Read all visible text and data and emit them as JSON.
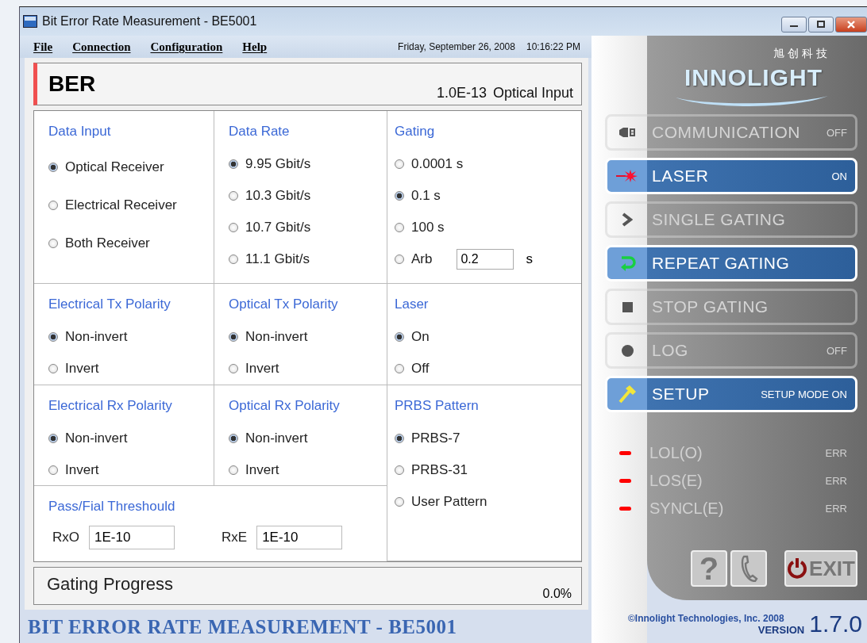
{
  "window": {
    "title": "Bit Error Rate Measurement - BE5001"
  },
  "menu": [
    {
      "label": "File"
    },
    {
      "label": "Connection"
    },
    {
      "label": "Configuration"
    },
    {
      "label": "Help"
    }
  ],
  "clock": {
    "date": "Friday, September 26, 2008",
    "time": "10:16:22 PM"
  },
  "ber": {
    "title": "BER",
    "value": "1.0E-13",
    "source": "Optical Input"
  },
  "groups": [
    {
      "title": "Data Input",
      "options": [
        {
          "label": "Optical Receiver",
          "selected": true
        },
        {
          "label": "Electrical Receiver",
          "selected": false
        },
        {
          "label": "Both Receiver",
          "selected": false
        }
      ]
    },
    {
      "title": "Data Rate",
      "options": [
        {
          "label": "9.95 Gbit/s",
          "selected": true
        },
        {
          "label": "10.3 Gbit/s",
          "selected": false
        },
        {
          "label": "10.7 Gbit/s",
          "selected": false
        },
        {
          "label": "11.1 Gbit/s",
          "selected": false
        }
      ]
    },
    {
      "title": "Gating",
      "options": [
        {
          "label": "0.0001 s",
          "selected": false
        },
        {
          "label": "0.1 s",
          "selected": true
        },
        {
          "label": "100 s",
          "selected": false
        },
        {
          "label": "Arb",
          "selected": false,
          "value": "0.2",
          "unit": "s"
        }
      ]
    },
    {
      "title": "Electrical Tx Polarity",
      "options": [
        {
          "label": "Non-invert",
          "selected": true
        },
        {
          "label": "Invert",
          "selected": false
        }
      ]
    },
    {
      "title": "Optical Tx Polarity",
      "options": [
        {
          "label": "Non-invert",
          "selected": true
        },
        {
          "label": "Invert",
          "selected": false
        }
      ]
    },
    {
      "title": "Laser",
      "options": [
        {
          "label": "On",
          "selected": true
        },
        {
          "label": "Off",
          "selected": false
        }
      ]
    },
    {
      "title": "Electrical Rx Polarity",
      "options": [
        {
          "label": "Non-invert",
          "selected": true
        },
        {
          "label": "Invert",
          "selected": false
        }
      ]
    },
    {
      "title": "Optical Rx Polarity",
      "options": [
        {
          "label": "Non-invert",
          "selected": true
        },
        {
          "label": "Invert",
          "selected": false
        }
      ]
    },
    {
      "title": "PRBS Pattern",
      "options": [
        {
          "label": "PRBS-7",
          "selected": true
        },
        {
          "label": "PRBS-31",
          "selected": false
        },
        {
          "label": "User Pattern",
          "selected": false
        }
      ]
    }
  ],
  "threshold": {
    "title": "Pass/Fial Threshould",
    "fields": [
      {
        "label": "RxO",
        "value": "1E-10"
      },
      {
        "label": "RxE",
        "value": "1E-10"
      }
    ]
  },
  "progress": {
    "label": "Gating Progress",
    "reading": "0.0%"
  },
  "footer_title": "BIT ERROR RATE MEASUREMENT - BE5001",
  "logo": {
    "name": "INNOLIGHT",
    "subtitle": "旭创科技"
  },
  "controls": [
    {
      "label": "COMMUNICATION",
      "status": "OFF",
      "active": false
    },
    {
      "label": "LASER",
      "status": "ON",
      "active": true
    },
    {
      "label": "SINGLE GATING",
      "active": false
    },
    {
      "label": "REPEAT GATING",
      "active": true
    },
    {
      "label": "STOP GATING",
      "active": false
    },
    {
      "label": "LOG",
      "status": "OFF",
      "active": false
    },
    {
      "label": "SETUP",
      "status": "SETUP MODE ON",
      "active": true
    }
  ],
  "indicators": [
    {
      "label": "LOL(O)",
      "status": "ERR",
      "alarm": true
    },
    {
      "label": "LOS(E)",
      "status": "ERR",
      "alarm": true
    },
    {
      "label": "SYNCL(E)",
      "status": "ERR",
      "alarm": true
    }
  ],
  "help_button": "?",
  "exit_button": "EXIT",
  "copyright": "©Innolight Technologies, Inc. 2008",
  "version": {
    "label": "VERSION",
    "number": "1.7.0"
  }
}
